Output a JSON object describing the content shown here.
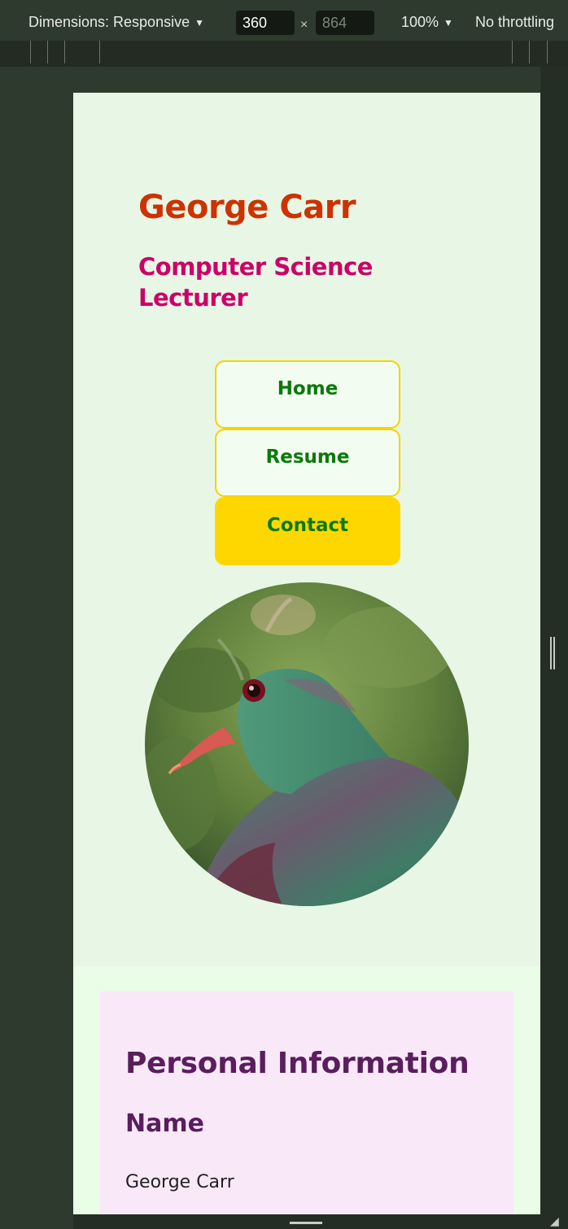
{
  "devtools": {
    "dimensions_label": "Dimensions: Responsive",
    "width_value": "360",
    "times": "×",
    "height_value": "864",
    "zoom_label": "100%",
    "throttle_label": "No throttling"
  },
  "site": {
    "title": "George Carr",
    "subtitle": "Computer Science Lecturer"
  },
  "nav": {
    "items": [
      {
        "label": "Home",
        "active": false
      },
      {
        "label": "Resume",
        "active": false
      },
      {
        "label": "Contact",
        "active": true
      }
    ]
  },
  "profile": {
    "image": "kereru-bird-photo"
  },
  "personal": {
    "heading": "Personal Information",
    "name_heading": "Name",
    "name_value": "George Carr"
  },
  "colors": {
    "title": "#cc3300",
    "subtitle": "#cc0066",
    "nav_text": "#0a7a0a",
    "nav_border": "#f5d300",
    "nav_active": "#ffd700",
    "section_heading": "#5a1d5e",
    "page_bg": "#e8f6e6",
    "card_bg": "#f9e8f8"
  }
}
